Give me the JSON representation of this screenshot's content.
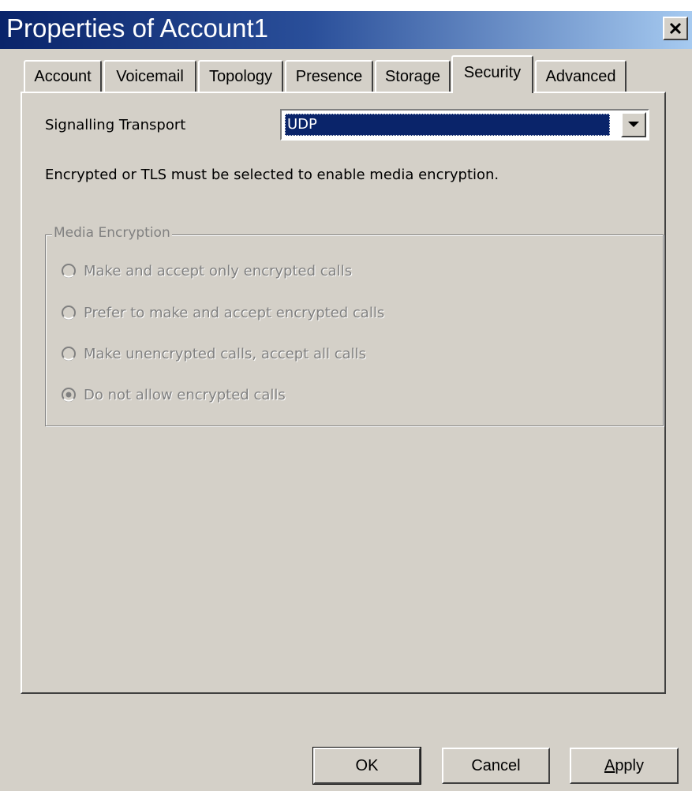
{
  "window": {
    "title": "Properties of Account1"
  },
  "tabs": [
    {
      "label": "Account",
      "active": false
    },
    {
      "label": "Voicemail",
      "active": false
    },
    {
      "label": "Topology",
      "active": false
    },
    {
      "label": "Presence",
      "active": false
    },
    {
      "label": "Storage",
      "active": false
    },
    {
      "label": "Security",
      "active": true
    },
    {
      "label": "Advanced",
      "active": false
    }
  ],
  "security": {
    "signalling_label": "Signalling Transport",
    "signalling_value": "UDP",
    "info_text": "Encrypted or TLS must be selected to enable media encryption.",
    "media_encryption": {
      "legend": "Media Encryption",
      "enabled": false,
      "options": [
        {
          "label": "Make and accept only encrypted calls",
          "selected": false
        },
        {
          "label": "Prefer to make and accept encrypted calls",
          "selected": false
        },
        {
          "label": "Make unencrypted calls, accept all calls",
          "selected": false
        },
        {
          "label": "Do not allow encrypted calls",
          "selected": true
        }
      ]
    }
  },
  "buttons": {
    "ok": "OK",
    "cancel": "Cancel",
    "apply_prefix": "",
    "apply_access": "A",
    "apply_rest": "pply"
  },
  "icons": {
    "close": "close-icon",
    "dropdown": "chevron-down-icon"
  },
  "colors": {
    "titlebar_start": "#0a246a",
    "titlebar_end": "#a6caf0",
    "selection": "#0a246a",
    "dialog_bg": "#d4d0c8",
    "disabled_text": "#808080"
  }
}
